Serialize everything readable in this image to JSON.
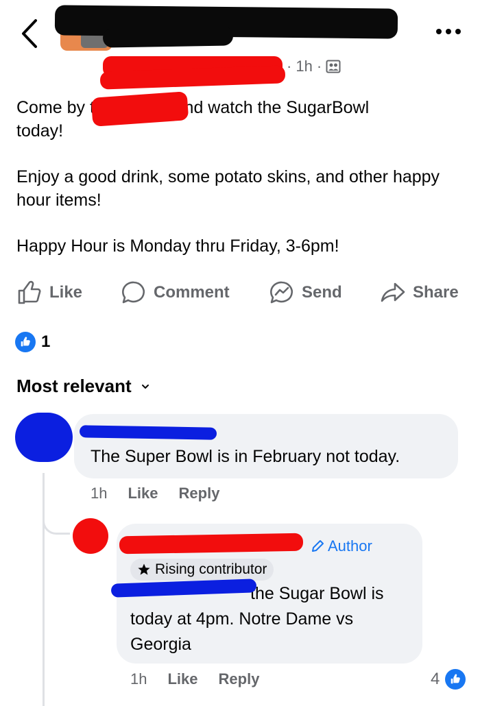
{
  "header": {
    "page_name_line1": "",
    "page_name_line2": "",
    "time": "1h"
  },
  "post": {
    "paragraphs": [
      "Come by th          se and watch the SugarBowl\ntoday!",
      "Enjoy a good drink, some potato skins, and other happy hour items!",
      "Happy Hour is Monday thru Friday, 3-6pm!"
    ]
  },
  "actions": {
    "like": "Like",
    "comment": "Comment",
    "send": "Send",
    "share": "Share"
  },
  "reactions": {
    "count": "1"
  },
  "sort": {
    "label": "Most relevant"
  },
  "comments": [
    {
      "text": "The Super Bowl is in February not today.",
      "time": "1h",
      "like": "Like",
      "reply": "Reply"
    },
    {
      "author_badge": "Author",
      "contributor_badge": "Rising contributor",
      "text_line1": "the Sugar Bowl is",
      "text_rest": "today at 4pm. Notre Dame vs Georgia",
      "time": "1h",
      "like": "Like",
      "reply": "Reply",
      "reaction_count": "4"
    }
  ],
  "colors": {
    "accent": "#1877f2",
    "muted": "#65676b",
    "bubble": "#f0f2f5",
    "redact_black": "#0a0a0a",
    "redact_red": "#f20d0d",
    "redact_blue": "#0b1fe0"
  }
}
